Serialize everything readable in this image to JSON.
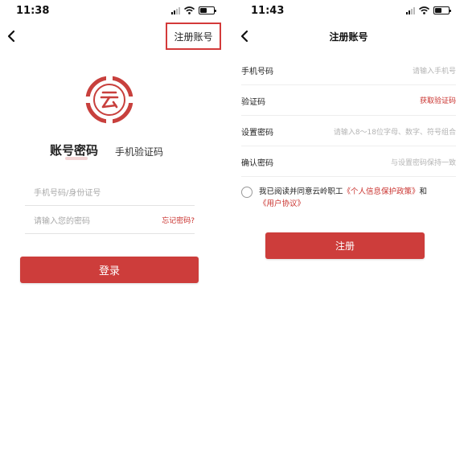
{
  "left_screen": {
    "time": "11:38",
    "register_link": "注册账号",
    "tabs": {
      "password": "账号密码",
      "sms": "手机验证码"
    },
    "phone_placeholder": "手机号码/身份证号",
    "password_placeholder": "请输入您的密码",
    "forgot_password": "忘记密码?",
    "login_button": "登录",
    "logo_glyph": "云",
    "battery_level": 0.5
  },
  "right_screen": {
    "time": "11:43",
    "title": "注册账号",
    "fields": [
      {
        "label": "手机号码",
        "placeholder": "请输入手机号"
      },
      {
        "label": "验证码",
        "action": "获取验证码"
      },
      {
        "label": "设置密码",
        "placeholder": "请输入8～18位字母、数字、符号组合"
      },
      {
        "label": "确认密码",
        "placeholder": "与设置密码保持一致"
      }
    ],
    "agreement": {
      "prefix": "我已阅读并同意云岭职工",
      "privacy_link": "《个人信息保护政策》",
      "conjunction": "和",
      "terms_link": "《用户协议》"
    },
    "register_button": "注册",
    "battery_level": 0.5
  },
  "colors": {
    "accent": "#cd3d3b",
    "link": "#c9302c",
    "highlight_border": "#d33a3a"
  },
  "icons": [
    "back-arrow-icon",
    "signal-icon",
    "wifi-icon",
    "battery-icon",
    "logo-icon",
    "radio-unchecked-icon"
  ]
}
